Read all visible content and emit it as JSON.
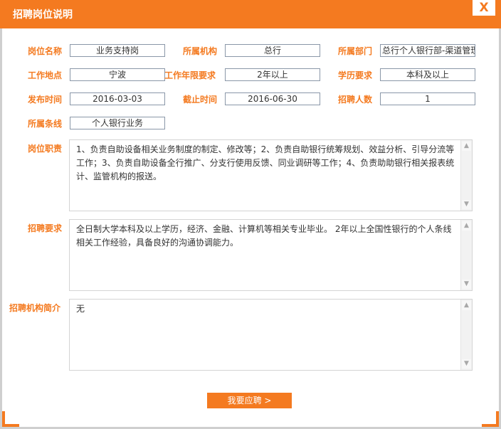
{
  "window": {
    "title": "招聘岗位说明",
    "close_label": "X"
  },
  "fields": {
    "position_name": {
      "label": "岗位名称",
      "value": "业务支持岗"
    },
    "institution": {
      "label": "所属机构",
      "value": "总行"
    },
    "department": {
      "label": "所属部门",
      "value": "总行个人银行部-渠道管理"
    },
    "location": {
      "label": "工作地点",
      "value": "宁波"
    },
    "experience": {
      "label": "工作年限要求",
      "value": "2年以上"
    },
    "education": {
      "label": "学历要求",
      "value": "本科及以上"
    },
    "publish_date": {
      "label": "发布时间",
      "value": "2016-03-03"
    },
    "deadline": {
      "label": "截止时间",
      "value": "2016-06-30"
    },
    "headcount": {
      "label": "招聘人数",
      "value": "1"
    },
    "business_line": {
      "label": "所属条线",
      "value": "个人银行业务"
    }
  },
  "sections": {
    "duties": {
      "label": "岗位职责",
      "text": "1、负责自助设备相关业务制度的制定、修改等；2、负责自助银行统筹规划、效益分析、引导分流等工作；3、负责自助设备全行推广、分支行使用反馈、同业调研等工作；4、负责助助银行相关报表统计、监管机构的报送。"
    },
    "requirements": {
      "label": "招聘要求",
      "text": "全日制大学本科及以上学历，经济、金融、计算机等相关专业毕业。 2年以上全国性银行的个人条线相关工作经验，具备良好的沟通协调能力。"
    },
    "intro": {
      "label": "招聘机构简介",
      "text": "无"
    }
  },
  "actions": {
    "apply_label": "我要应聘 >"
  },
  "colors": {
    "accent": "#f47a20",
    "field_border": "#8a97a8"
  },
  "icons": {
    "scroll_up": "scroll-up-arrow-icon",
    "scroll_down": "scroll-down-arrow-icon"
  }
}
